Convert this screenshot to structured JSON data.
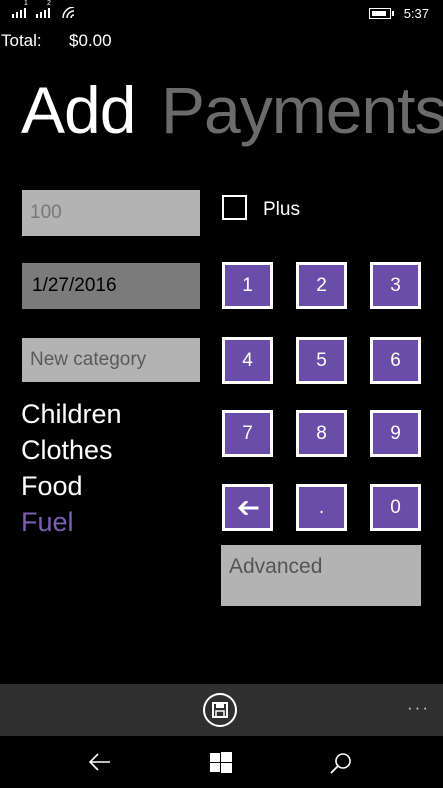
{
  "status": {
    "time": "5:37",
    "sim1": "1",
    "sim2": "2"
  },
  "header": {
    "total_label": "Total:",
    "total_value": "$0.00"
  },
  "pivot": {
    "active": "Add",
    "inactive": "Payments"
  },
  "form": {
    "amount_placeholder": "100",
    "date_value": "1/27/2016",
    "category_placeholder": "New category",
    "plus_label": "Plus",
    "plus_checked": false,
    "advanced_placeholder": "Advanced"
  },
  "categories": [
    {
      "label": "Children",
      "selected": false
    },
    {
      "label": "Clothes",
      "selected": false
    },
    {
      "label": "Food",
      "selected": false
    },
    {
      "label": "Fuel",
      "selected": true
    }
  ],
  "keypad": {
    "k1": "1",
    "k2": "2",
    "k3": "3",
    "k4": "4",
    "k5": "5",
    "k6": "6",
    "k7": "7",
    "k8": "8",
    "k9": "9",
    "backspace": "←",
    "dot": ".",
    "k0": "0"
  },
  "appbar": {
    "save_icon": "save-icon",
    "more": "···"
  },
  "colors": {
    "accent": "#6a4da8",
    "selected_category": "#7b5fb2",
    "field_bg": "#b3b3b3",
    "date_bg": "#7b7b7b",
    "appbar_bg": "#2f2f2f"
  }
}
